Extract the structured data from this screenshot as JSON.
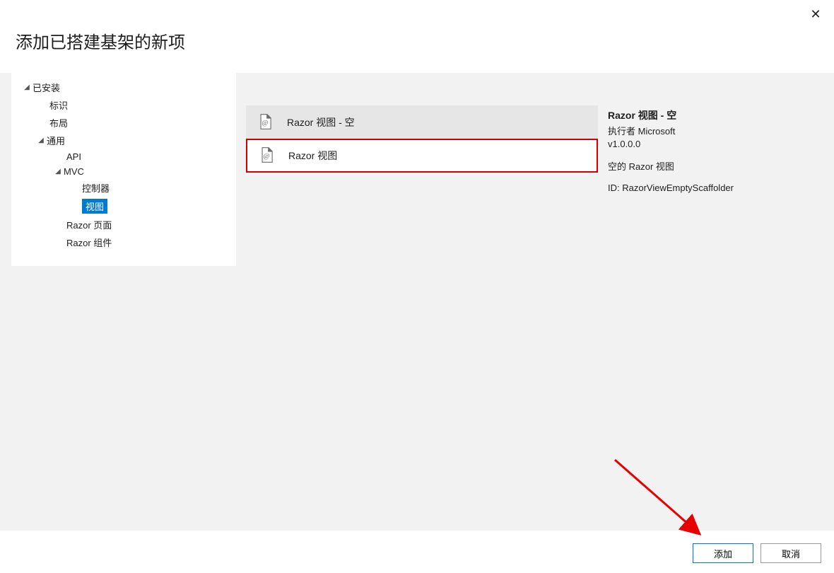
{
  "dialog": {
    "title": "添加已搭建基架的新项",
    "close_label": "✕"
  },
  "sidebar": {
    "root": "已安装",
    "items": {
      "identity": "标识",
      "layout": "布局",
      "common": "通用",
      "api": "API",
      "mvc": "MVC",
      "controller": "控制器",
      "view": "视图",
      "razor_pages": "Razor 页面",
      "razor_components": "Razor 组件"
    }
  },
  "templates": {
    "razor_view_empty": "Razor 视图 - 空",
    "razor_view": "Razor 视图"
  },
  "details": {
    "title": "Razor 视图 - 空",
    "publisher": "执行者 Microsoft",
    "version": "v1.0.0.0",
    "description": "空的 Razor 视图",
    "id": "ID: RazorViewEmptyScaffolder"
  },
  "buttons": {
    "add": "添加",
    "cancel": "取消"
  }
}
